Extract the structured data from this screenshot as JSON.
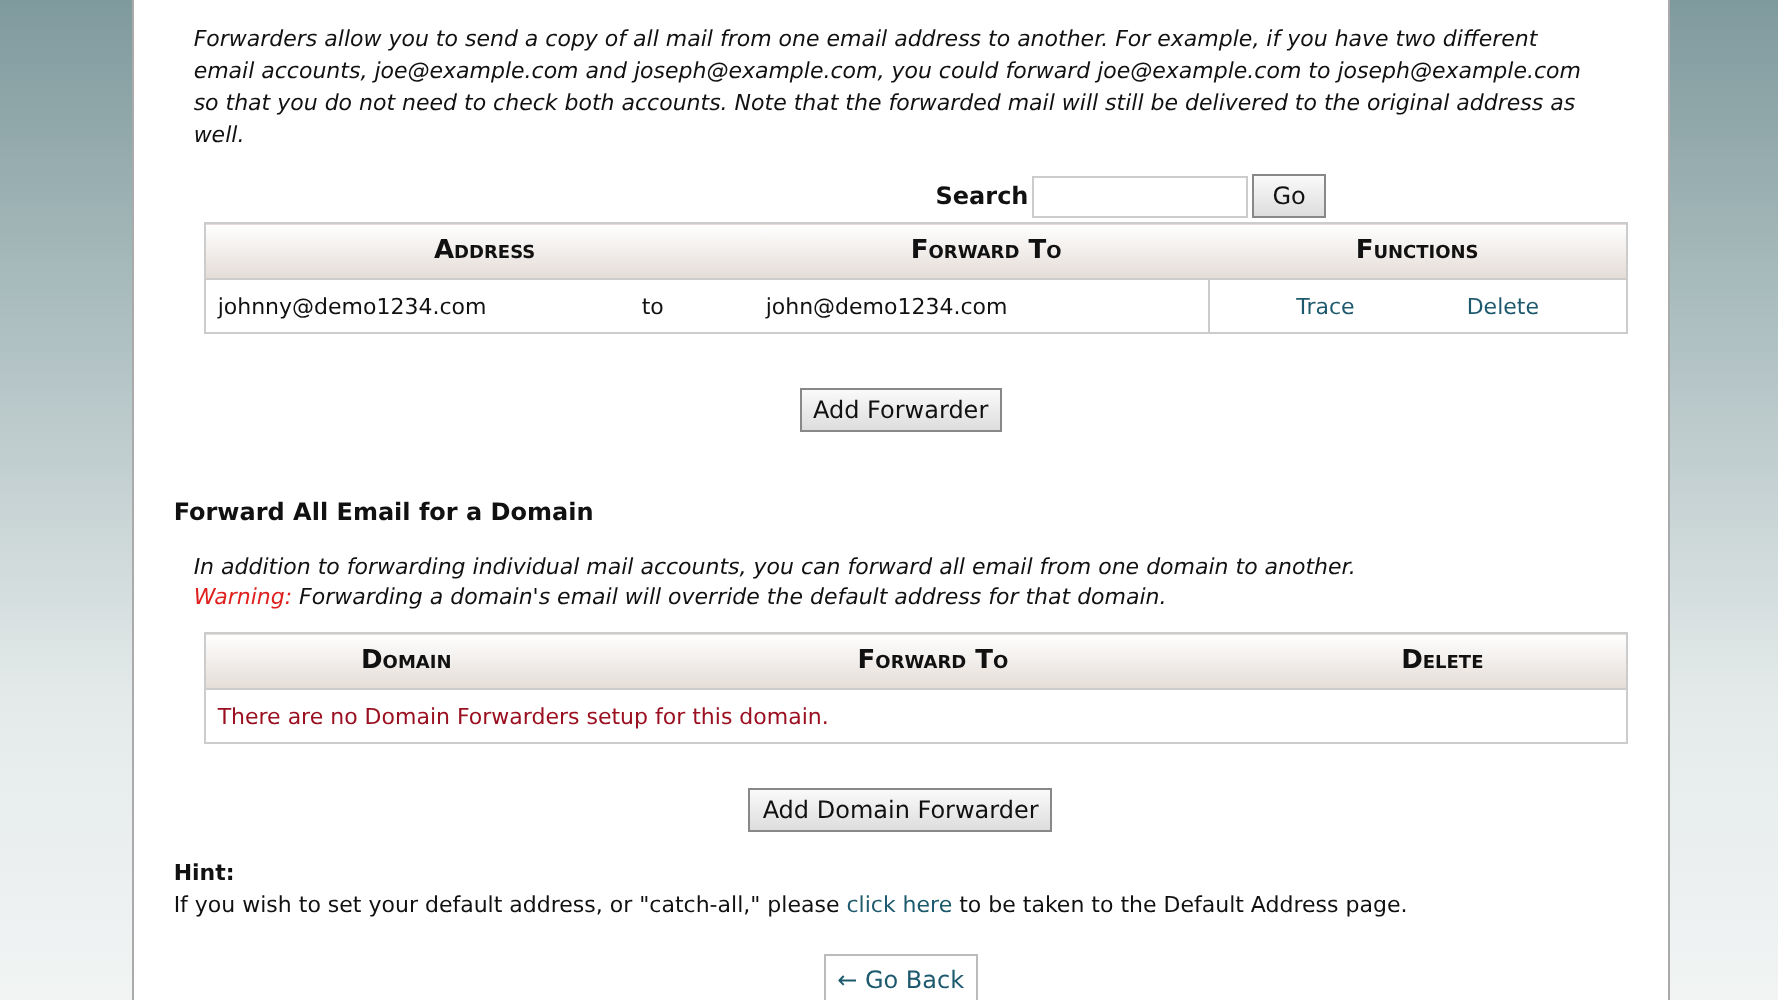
{
  "intro": "Forwarders allow you to send a copy of all mail from one email address to another. For example, if you have two different email accounts, joe@example.com and joseph@example.com, you could forward joe@example.com to joseph@example.com so that you do not need to check both accounts. Note that the forwarded mail will still be delivered to the original address as well.",
  "search": {
    "label": "Search",
    "button": "Go"
  },
  "forwarders": {
    "columns": [
      "Address",
      "Forward To",
      "Functions"
    ],
    "rows": [
      {
        "address": "johnny@demo1234.com",
        "joiner": "to",
        "forward_to": "john@demo1234.com",
        "actions": [
          "Trace",
          "Delete"
        ]
      }
    ]
  },
  "add_forwarder_button": "Add Forwarder",
  "domain_section": {
    "title": "Forward All Email for a Domain",
    "description": "In addition to forwarding individual mail accounts, you can forward all email from one domain to another.",
    "warning_label": "Warning:",
    "warning_text": "Forwarding a domain's email will override the default address for that domain.",
    "columns": [
      "Domain",
      "Forward To",
      "Delete"
    ],
    "empty_message": "There are no Domain Forwarders setup for this domain.",
    "add_button": "Add Domain Forwarder"
  },
  "hint": {
    "title": "Hint:",
    "before": "If you wish to set your default address, or \"catch-all,\" please",
    "link": "click here",
    "after": "to be taken to the Default Address page."
  },
  "back_button": "← Go Back"
}
